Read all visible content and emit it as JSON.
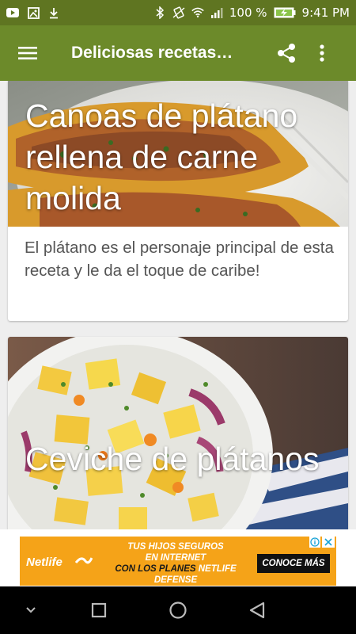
{
  "status_bar": {
    "left_icons": [
      "youtube-icon",
      "gallery-icon",
      "download-icon"
    ],
    "right_icons": [
      "bluetooth-icon",
      "vibrate-icon",
      "wifi-icon",
      "signal-icon",
      "battery-icon"
    ],
    "battery": "100 %",
    "time": "9:41 PM"
  },
  "app_bar": {
    "title": "Deliciosas recetas…",
    "icons": [
      "menu-icon",
      "share-icon",
      "more-vert-icon"
    ]
  },
  "cards": [
    {
      "title": "Canoas de plátano rellena de carne molida",
      "description": "El plátano es el personaje principal de esta receta y le da el toque de caribe!"
    },
    {
      "title": "Ceviche de plátanos"
    }
  ],
  "ad": {
    "brand": "Netlife",
    "line1": "TUS HIJOS SEGUROS",
    "line2": "EN INTERNET",
    "line3_prefix": "CON LOS PLANES ",
    "line3_highlight": "NETLIFE DEFENSE",
    "cta": "CONOCE MÁS",
    "icons": [
      "adchoices-info-icon",
      "ad-close-icon"
    ]
  },
  "nav_bar": {
    "icons": [
      "hide-keyboard-icon",
      "recents-icon",
      "home-icon",
      "back-icon"
    ]
  },
  "colors": {
    "status_bar": "#5f7521",
    "app_bar": "#6c8a2a",
    "background": "#eeeeee",
    "ad_background": "#f5a318"
  }
}
